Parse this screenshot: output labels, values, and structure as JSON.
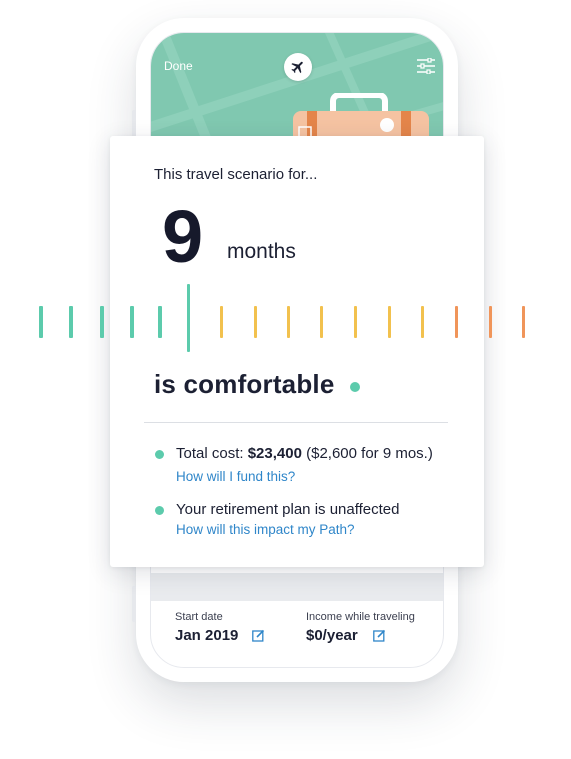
{
  "header": {
    "done_label": "Done",
    "plane_icon": "airplane-icon",
    "filter_icon": "sliders-icon"
  },
  "card": {
    "intro": "This travel scenario for...",
    "months_value": "9",
    "months_unit": "months",
    "status_text": "is comfortable",
    "status_color": "#5ccbac",
    "items": [
      {
        "prefix": "Total cost: ",
        "bold": "$23,400",
        "suffix": " ($2,600 for 9 mos.)",
        "link": "How will I fund this?"
      },
      {
        "prefix": "Your retirement plan is unaffected",
        "bold": "",
        "suffix": "",
        "link": "How will this impact my Path?"
      }
    ]
  },
  "ruler": {
    "selected_months": 9,
    "ticks_before": 5,
    "ticks_after": 10,
    "colors": {
      "comfortable": "#5ccbac",
      "caution": "#f2c14e",
      "risky": "#f0955a"
    }
  },
  "details": {
    "start_label": "Start date",
    "start_value": "Jan 2019",
    "income_label": "Income while traveling",
    "income_value": "$0/year",
    "edit_icon": "edit-icon"
  },
  "colors": {
    "map_green": "#80c8b0",
    "suitcase": "#f5c3a2",
    "suitcase_strap": "#e4854a",
    "link": "#2f86c9"
  }
}
